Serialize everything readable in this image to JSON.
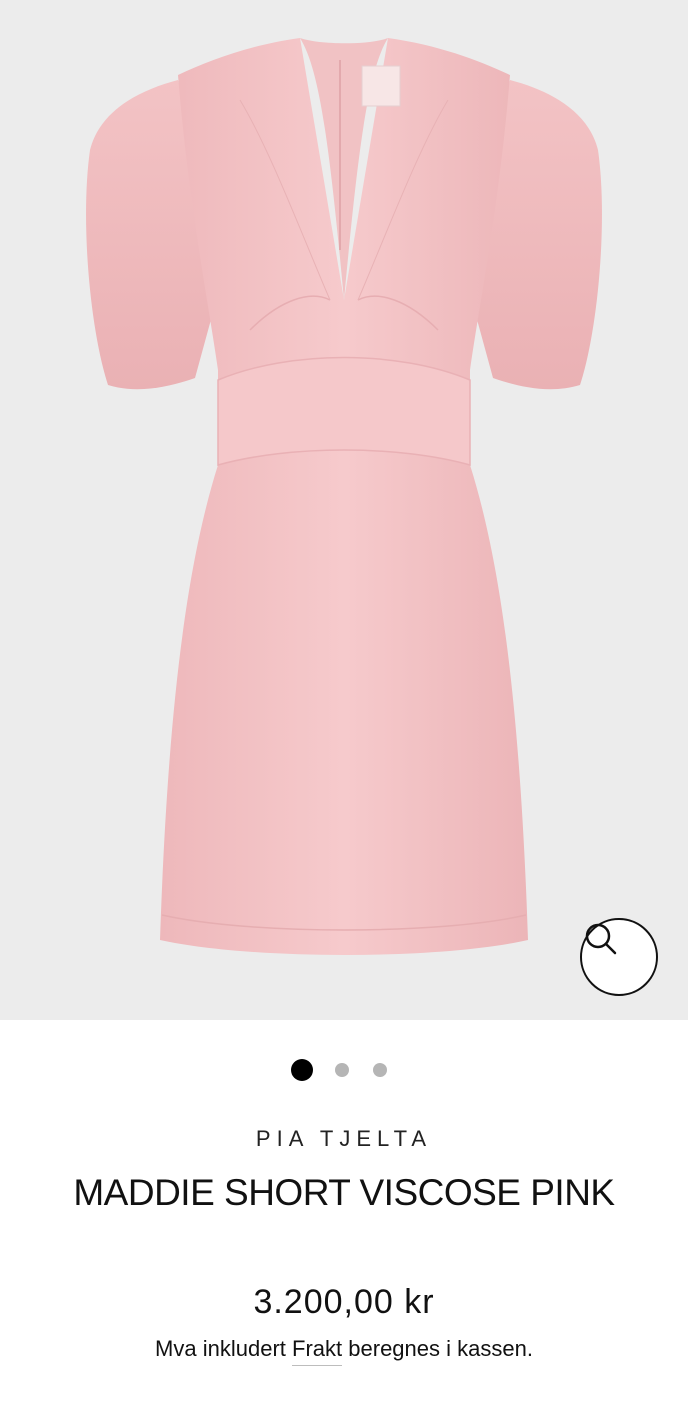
{
  "product": {
    "brand": "PIA TJELTA",
    "title": "MADDIE SHORT VISCOSE PINK",
    "price": "3.200,00 kr",
    "tax_prefix": "Mva inkludert",
    "shipping_link": "Frakt",
    "tax_suffix": "beregnes i kassen."
  },
  "gallery": {
    "image_count": 3,
    "active_index": 1,
    "zoom_icon": "search-icon"
  },
  "colors": {
    "dress": "#f4c5c7",
    "background": "#ececec",
    "active_dot": "#000000",
    "inactive_dot": "#b5b5b5"
  }
}
